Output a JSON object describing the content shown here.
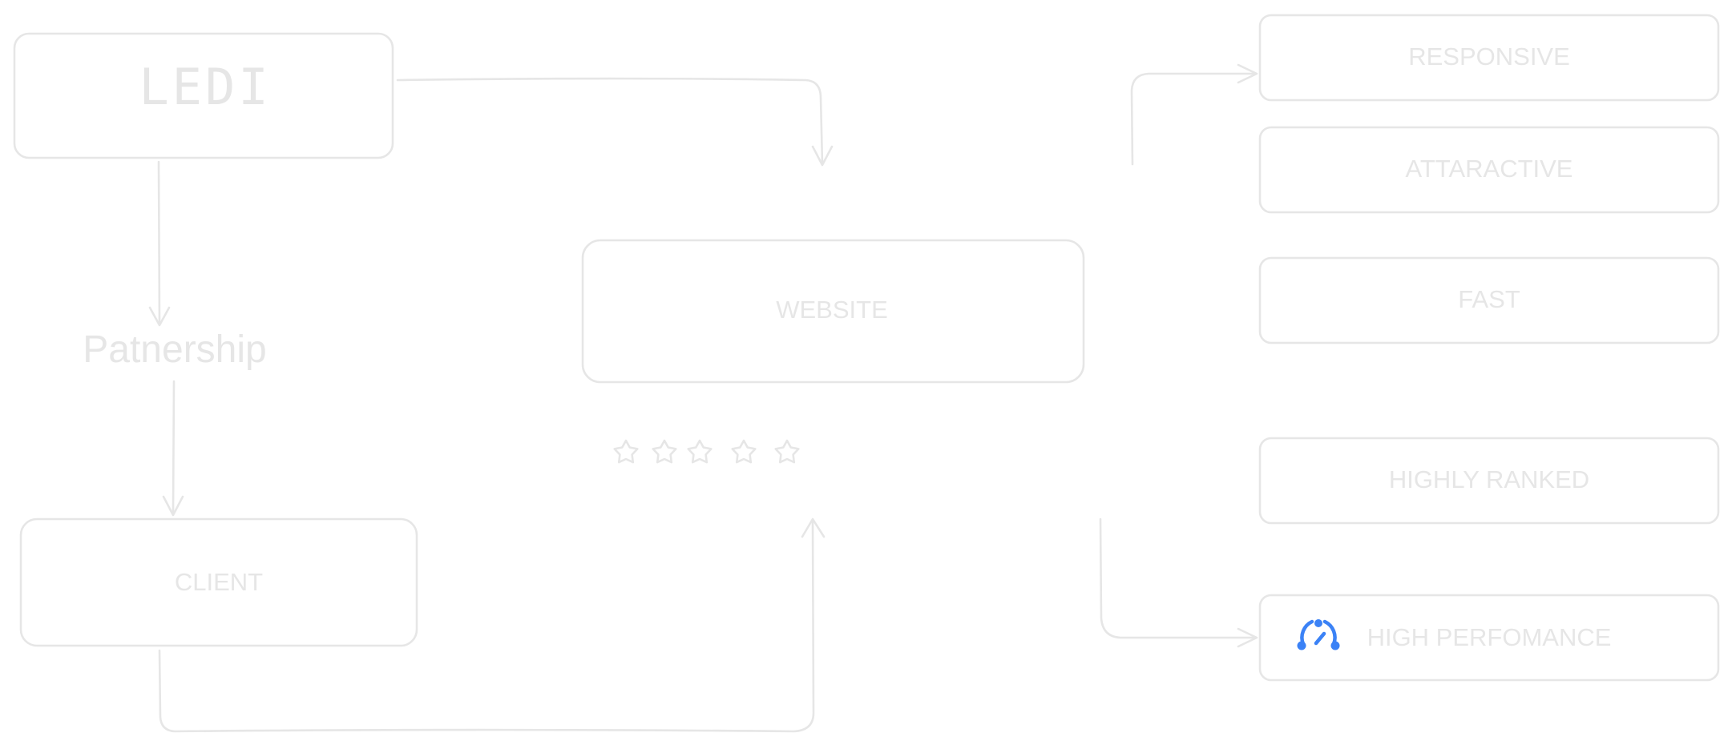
{
  "diagram": {
    "title_box": {
      "label": "LEDI"
    },
    "partnership": {
      "label": "Patnership"
    },
    "client": {
      "label": "CLIENT"
    },
    "website": {
      "label": "WEBSITE"
    },
    "rating": {
      "stars": 5,
      "filled": 0
    },
    "features": [
      {
        "label": "RESPONSIVE"
      },
      {
        "label": "ATTARACTIVE"
      },
      {
        "label": "FAST"
      },
      {
        "label": "HIGHLY RANKED"
      },
      {
        "label": "HIGH PERFOMANCE",
        "icon": "speedometer-icon"
      }
    ],
    "colors": {
      "stroke": "#e6e6e6",
      "text": "#e6e6e6",
      "icon_accent": "#3b82f6",
      "background": "#ffffff"
    }
  }
}
